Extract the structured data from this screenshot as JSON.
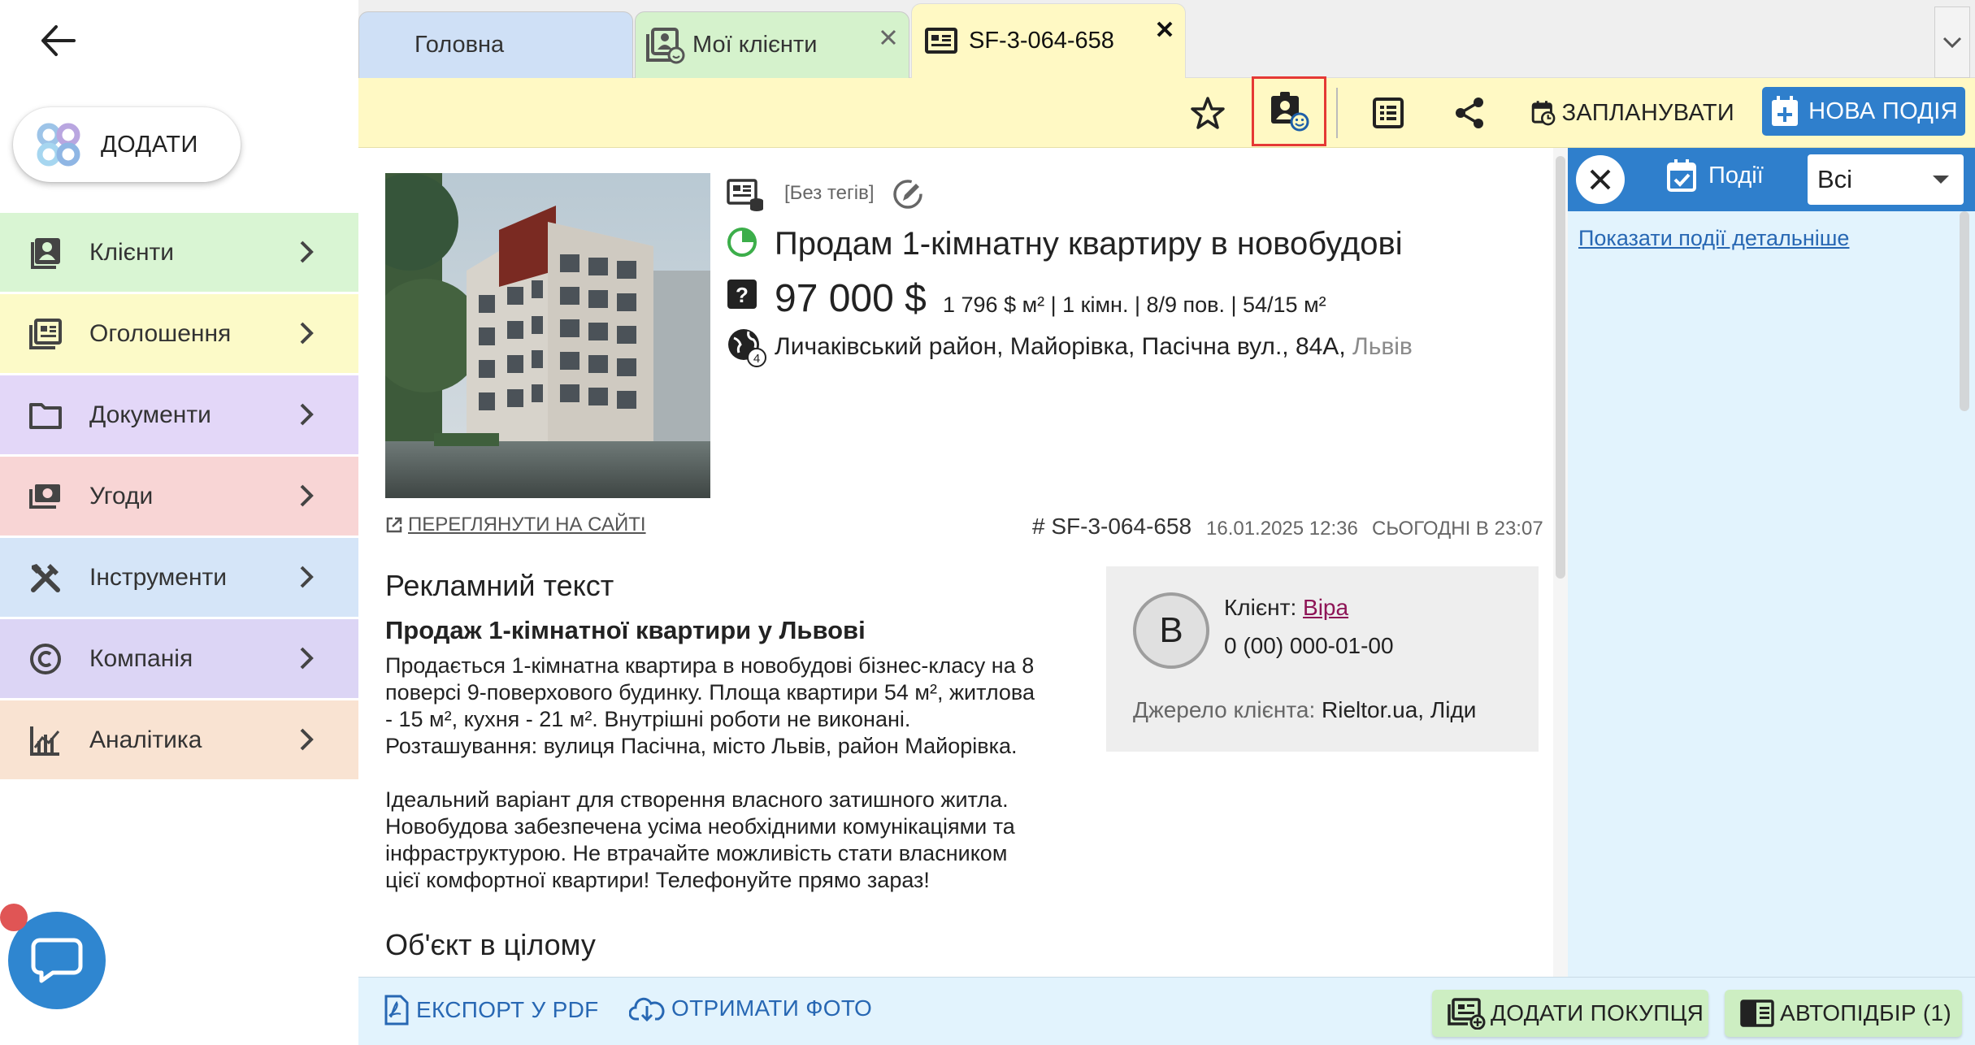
{
  "sidebar": {
    "add_label": "ДОДАТИ",
    "items": [
      {
        "label": "Клієнти",
        "color": "#d9f5d3"
      },
      {
        "label": "Оголошення",
        "color": "#fcfac8"
      },
      {
        "label": "Документи",
        "color": "#e3d7f8"
      },
      {
        "label": "Угоди",
        "color": "#f8d5d5"
      },
      {
        "label": "Інструменти",
        "color": "#d5e5f8"
      },
      {
        "label": "Компанія",
        "color": "#dcd5f5"
      },
      {
        "label": "Аналітика",
        "color": "#f9e3d2"
      }
    ]
  },
  "tabs": [
    {
      "label": "Головна"
    },
    {
      "label": "Мої клієнти"
    },
    {
      "label": "SF-3-064-658"
    }
  ],
  "toolbar": {
    "plan_label": "ЗАПЛАНУВАТИ",
    "new_event_label": "НОВА ПОДІЯ"
  },
  "object": {
    "tags": "[Без тегів]",
    "title": "Продам 1-кімнатну квартиру в новобудові",
    "price": "97 000 $",
    "params": "1 796 $ м² | 1 кімн. | 8/9 пов. | 54/15 м²",
    "address": "Личаківський район, Майорівка, Пасічна вул., 84А,",
    "city": "Львів",
    "geo_badge": "4",
    "view_site_label": "ПЕРЕГЛЯНУТИ НА САЙТІ",
    "id": "# SF-3-064-658",
    "created": "16.01.2025 12:36",
    "updated": "СЬОГОДНІ В 23:07"
  },
  "ad": {
    "heading": "Рекламний текст",
    "subtitle": "Продаж 1-кімнатної квартири у Львові",
    "lines": [
      "Продається 1-кімнатна квартира в новобудові бізнес-класу на 8",
      "поверсі 9-поверхового будинку. Площа квартири 54 м², житлова",
      "- 15 м², кухня - 21 м². Внутрішні роботи не виконані.",
      "Розташування: вулиця Пасічна, місто Львів, район Майорівка.",
      "",
      "Ідеальний варіант для створення власного затишного житла.",
      "Новобудова забезпечена усіма необхідними комунікаціями та",
      "інфраструктурою. Не втрачайте можливість стати власником",
      "цієї комфортної квартири! Телефонуйте прямо зараз!"
    ],
    "object_heading": "Об'єкт в цілому"
  },
  "client": {
    "initial": "В",
    "label": "Клієнт:",
    "name": "Віра",
    "phone": "0 (00) 000-01-00",
    "source_label": "Джерело клієнта:",
    "source_value": "Rieltor.ua, Ліди"
  },
  "events": {
    "tab_label": "Події",
    "filter_value": "Всі",
    "more_link": "Показати події детальніше"
  },
  "bottom": {
    "export_pdf": "ЕКСПОРТ У PDF",
    "get_photo": "ОТРИМАТИ ФОТО",
    "add_buyer": "ДОДАТИ ПОКУПЦЯ",
    "autoselect": "АВТОПІДБІР (1)"
  }
}
